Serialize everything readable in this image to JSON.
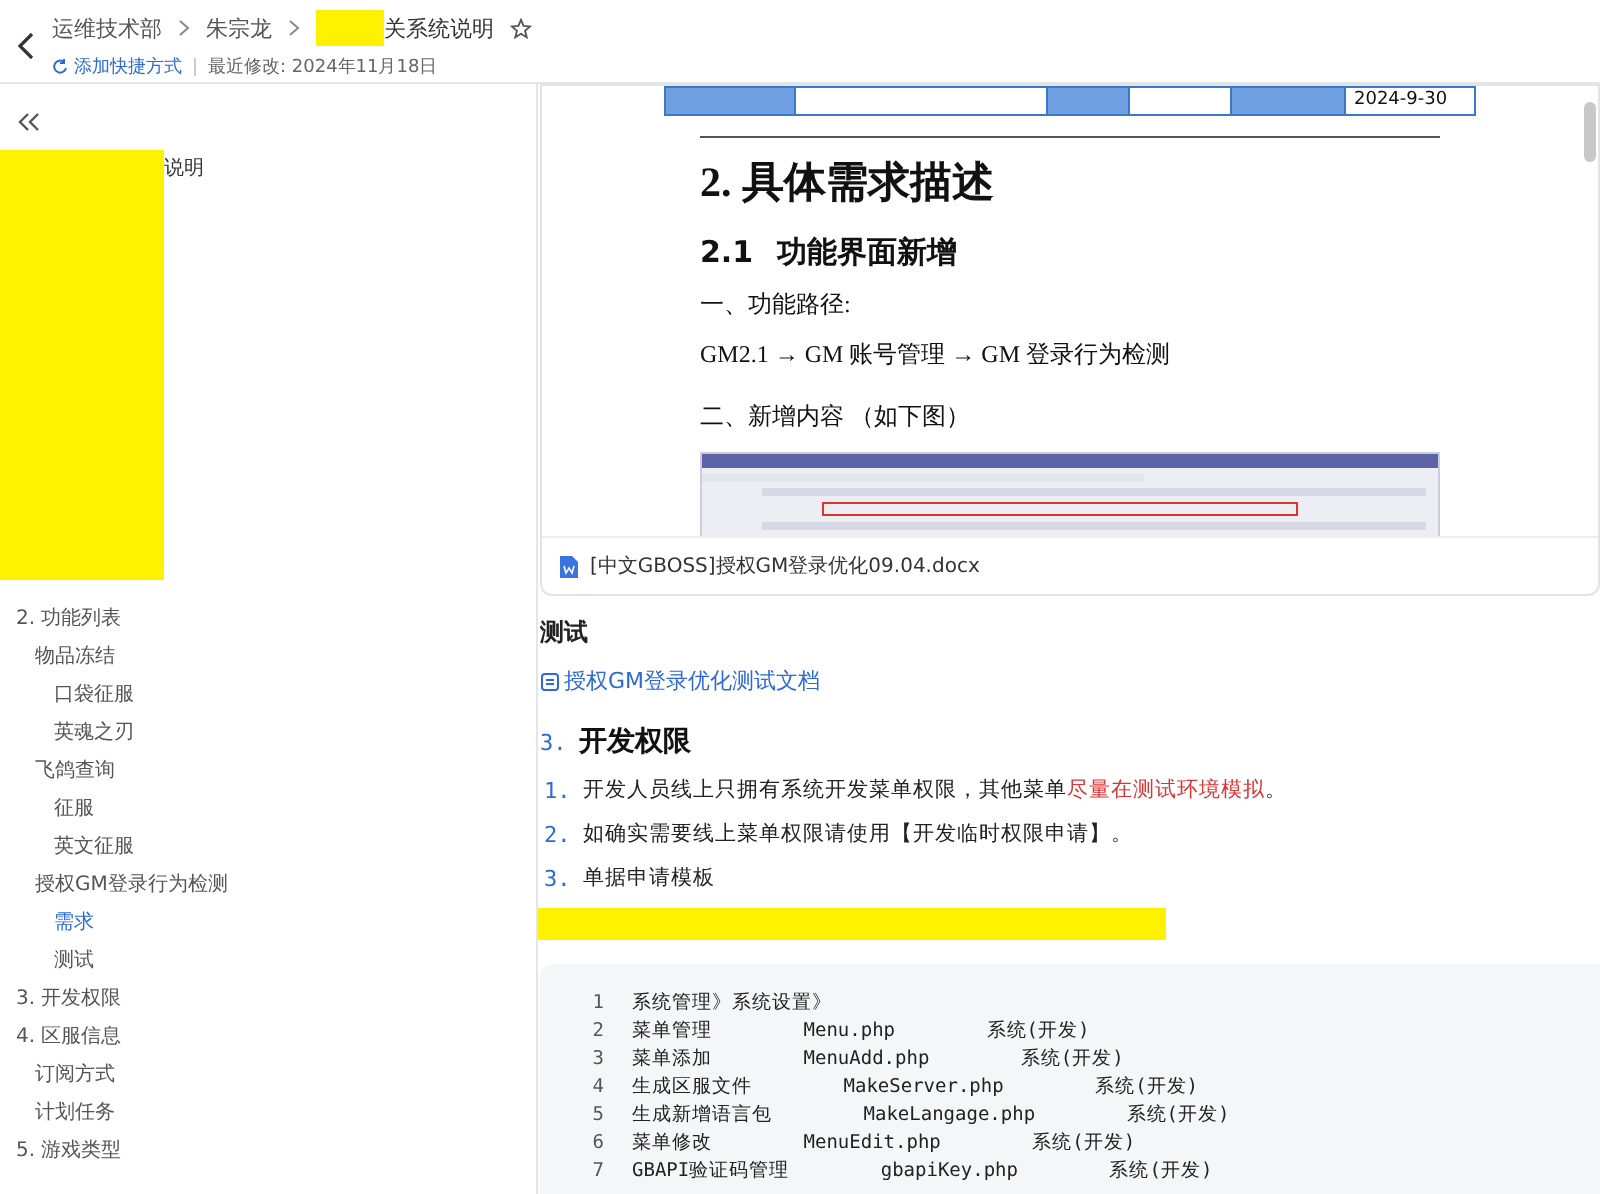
{
  "header": {
    "breadcrumb": [
      "运维技术部",
      "朱宗龙",
      "关系统说明"
    ],
    "shortcut": "添加快捷方式",
    "modified": "最近修改: 2024年11月18日"
  },
  "sidebar": {
    "title": "说明",
    "items": [
      {
        "label": "2. 功能列表",
        "selected": false,
        "children": [
          {
            "label": "物品冻结",
            "selected": false,
            "children": [
              {
                "label": "口袋征服",
                "selected": false
              },
              {
                "label": "英魂之刃",
                "selected": false
              }
            ]
          },
          {
            "label": "飞鸽查询",
            "selected": false,
            "children": [
              {
                "label": "征服",
                "selected": false
              },
              {
                "label": "英文征服",
                "selected": false
              }
            ]
          },
          {
            "label": "授权GM登录行为检测",
            "selected": false,
            "children": [
              {
                "label": "需求",
                "selected": true
              },
              {
                "label": "测试",
                "selected": false
              }
            ]
          }
        ]
      },
      {
        "label": "3. 开发权限",
        "selected": false
      },
      {
        "label": "4. 区服信息",
        "selected": false,
        "children": [
          {
            "label": "订阅方式",
            "selected": false
          },
          {
            "label": "计划任务",
            "selected": false
          }
        ]
      },
      {
        "label": "5. 游戏类型",
        "selected": false
      }
    ]
  },
  "preview": {
    "table_value": "2024-9-30",
    "heading": "2. 具体需求描述",
    "subheading_number": "2.1",
    "subheading": "功能界面新增",
    "path_label": "一、功能路径:",
    "path": "GM2.1 → GM 账号管理 → GM 登录行为检测",
    "new_label": "二、新增内容 （如下图）",
    "attachment": "[中文GBOSS]授权GM登录优化09.04.docx"
  },
  "test": {
    "heading": "测试",
    "link": "授权GM登录优化测试文档"
  },
  "section": {
    "number": "3.",
    "title": "开发权限"
  },
  "list": [
    {
      "number": "1.",
      "text": "开发人员线上只拥有系统开发菜单权限，其他菜单",
      "highlight": "尽量在测试环境模拟",
      "after": "。"
    },
    {
      "number": "2.",
      "text": "如确实需要线上菜单权限请使用【开发临时权限申请】。"
    },
    {
      "number": "3.",
      "text": "单据申请模板"
    }
  ],
  "code": [
    {
      "number": "1",
      "text": "系统管理》系统设置》"
    },
    {
      "number": "2",
      "text": "菜单管理        Menu.php        系统(开发)"
    },
    {
      "number": "3",
      "text": "菜单添加        MenuAdd.php        系统(开发)"
    },
    {
      "number": "4",
      "text": "生成区服文件        MakeServer.php        系统(开发)"
    },
    {
      "number": "5",
      "text": "生成新增语言包        MakeLangage.php        系统(开发)"
    },
    {
      "number": "6",
      "text": "菜单修改        MenuEdit.php        系统(开发)"
    },
    {
      "number": "7",
      "text": "GBAPI验证码管理        gbapiKey.php        系统(开发)"
    }
  ]
}
